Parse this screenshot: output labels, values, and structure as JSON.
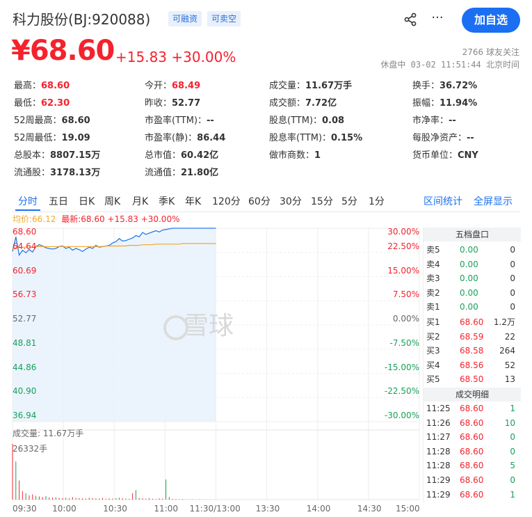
{
  "header": {
    "name": "科力股份(BJ:920088)",
    "tags": [
      "可融资",
      "可卖空"
    ],
    "add_watch": "加自选",
    "more": "···",
    "price": "¥68.60",
    "change": "+15.83 +30.00%",
    "followers": "2766 球友关注",
    "status": "休盘中 03-02 11:51:44 北京时间"
  },
  "stats": [
    [
      {
        "label": "最高：",
        "value": "68.60",
        "color": "red"
      },
      {
        "label": "今开：",
        "value": "68.49",
        "color": "red"
      },
      {
        "label": "成交量：",
        "value": "11.67万手"
      },
      {
        "label": "换手：",
        "value": "36.72%"
      }
    ],
    [
      {
        "label": "最低：",
        "value": "62.30",
        "color": "red"
      },
      {
        "label": "昨收：",
        "value": "52.77"
      },
      {
        "label": "成交额：",
        "value": "7.72亿"
      },
      {
        "label": "振幅：",
        "value": "11.94%"
      }
    ],
    [
      {
        "label": "52周最高：",
        "value": "68.60"
      },
      {
        "label": "市盈率(TTM)：",
        "value": "--"
      },
      {
        "label": "股息(TTM)：",
        "value": "0.08"
      },
      {
        "label": "市净率：",
        "value": "--"
      }
    ],
    [
      {
        "label": "52周最低：",
        "value": "19.09"
      },
      {
        "label": "市盈率(静)：",
        "value": "86.44"
      },
      {
        "label": "股息率(TTM)：",
        "value": "0.15%"
      },
      {
        "label": "每股净资产：",
        "value": "--"
      }
    ],
    [
      {
        "label": "总股本：",
        "value": "8807.15万"
      },
      {
        "label": "总市值：",
        "value": "60.42亿"
      },
      {
        "label": "做市商数：",
        "value": "1"
      },
      {
        "label": "货币单位：",
        "value": "CNY"
      }
    ],
    [
      {
        "label": "流通股：",
        "value": "3178.13万"
      },
      {
        "label": "流通值：",
        "value": "21.80亿"
      }
    ]
  ],
  "tabs": [
    "分时",
    "五日",
    "日K",
    "周K",
    "月K",
    "季K",
    "年K",
    "120分",
    "60分",
    "30分",
    "15分",
    "5分",
    "1分"
  ],
  "active_tab": 0,
  "right_links": [
    "区间统计",
    "全屏显示"
  ],
  "legend": {
    "avg": "均价:66.12",
    "latest": "最新:68.60 +15.83 +30.00%"
  },
  "watermark": "雪球",
  "chart_data": {
    "type": "line",
    "y_left_ticks": [
      "68.60",
      "64.64",
      "60.69",
      "56.73",
      "52.77",
      "48.81",
      "44.86",
      "40.90",
      "36.94"
    ],
    "y_right_ticks": [
      "30.00%",
      "22.50%",
      "15.00%",
      "7.50%",
      "0.00%",
      "-7.50%",
      "-15.00%",
      "-22.50%",
      "-30.00%"
    ],
    "ylim": [
      36.94,
      68.6
    ],
    "x_ticks": [
      "09:30",
      "10:00",
      "10:30",
      "11:00",
      "11:30/13:00",
      "13:30",
      "14:00",
      "14:30",
      "15:00"
    ],
    "price_series": [
      64.8,
      67.2,
      64.2,
      65.0,
      64.6,
      65.1,
      64.7,
      65.6,
      65.9,
      65.7,
      65.4,
      65.3,
      65.2,
      65.3,
      65.6,
      65.7,
      65.3,
      65.5,
      65.0,
      65.3,
      65.1,
      64.8,
      65.2,
      65.5,
      65.3,
      65.8,
      65.5,
      65.6,
      65.7,
      65.8,
      66.2,
      66.4,
      66.9,
      66.5,
      66.6,
      66.8,
      67.0,
      67.4,
      67.2,
      67.9,
      67.6,
      67.8,
      68.0,
      68.2,
      68.0,
      68.3,
      68.4,
      68.5,
      68.6,
      68.6,
      68.6,
      68.6,
      68.6,
      68.6,
      68.6,
      68.6,
      68.6,
      68.6,
      68.6,
      68.6,
      68.6,
      68.6
    ],
    "avg_series": [
      65.3,
      65.4,
      65.4,
      65.5,
      65.5,
      65.5,
      65.5,
      65.6,
      65.6,
      65.6,
      65.6,
      65.6,
      65.6,
      65.6,
      65.6,
      65.6,
      65.6,
      65.6,
      65.6,
      65.6,
      65.6,
      65.6,
      65.6,
      65.6,
      65.6,
      65.6,
      65.6,
      65.6,
      65.7,
      65.7,
      65.7,
      65.7,
      65.7,
      65.7,
      65.7,
      65.8,
      65.8,
      65.8,
      65.8,
      65.9,
      65.9,
      65.9,
      65.9,
      66.0,
      66.0,
      66.0,
      66.0,
      66.0,
      66.0,
      66.0,
      66.0,
      66.1,
      66.1,
      66.1,
      66.1,
      66.1,
      66.1,
      66.1,
      66.1,
      66.1,
      66.1,
      66.1
    ],
    "volume_title": "成交量: 11.67万手",
    "volume_max_label": "26332手",
    "volume_max": 26332,
    "volume_series": [
      26332,
      18000,
      9000,
      4000,
      3000,
      2000,
      2500,
      1800,
      1500,
      1200,
      1600,
      1000,
      900,
      1100,
      800,
      700,
      900,
      600,
      1200,
      800,
      700,
      600,
      500,
      900,
      700,
      600,
      500,
      800,
      400,
      600,
      500,
      700,
      900,
      600,
      500,
      400,
      3000,
      4500,
      800,
      600,
      500,
      700,
      400,
      300,
      600,
      500,
      9500,
      1200,
      400,
      300,
      200,
      300,
      150,
      100,
      150,
      100,
      120,
      80,
      60,
      50,
      40,
      30
    ]
  },
  "panel": {
    "title1": "五档盘口",
    "asks": [
      {
        "l": "卖5",
        "p": "0.00",
        "v": "0"
      },
      {
        "l": "卖4",
        "p": "0.00",
        "v": "0"
      },
      {
        "l": "卖3",
        "p": "0.00",
        "v": "0"
      },
      {
        "l": "卖2",
        "p": "0.00",
        "v": "0"
      },
      {
        "l": "卖1",
        "p": "0.00",
        "v": "0"
      }
    ],
    "bids": [
      {
        "l": "买1",
        "p": "68.60",
        "v": "1.2万"
      },
      {
        "l": "买2",
        "p": "68.59",
        "v": "22"
      },
      {
        "l": "买3",
        "p": "68.58",
        "v": "264"
      },
      {
        "l": "买4",
        "p": "68.56",
        "v": "52"
      },
      {
        "l": "买5",
        "p": "68.50",
        "v": "13"
      }
    ],
    "title2": "成交明细",
    "trades": [
      {
        "t": "11:25",
        "p": "68.60",
        "v": "1"
      },
      {
        "t": "11:26",
        "p": "68.60",
        "v": "10"
      },
      {
        "t": "11:27",
        "p": "68.60",
        "v": "0"
      },
      {
        "t": "11:28",
        "p": "68.60",
        "v": "0"
      },
      {
        "t": "11:28",
        "p": "68.60",
        "v": "5"
      },
      {
        "t": "11:29",
        "p": "68.60",
        "v": "0"
      },
      {
        "t": "11:29",
        "p": "68.60",
        "v": "1"
      }
    ]
  },
  "colors": {
    "up": "#f5222d",
    "down": "#18a058",
    "accent": "#1b6ff2",
    "avg": "#f5a623",
    "price": "#2a7be4"
  }
}
